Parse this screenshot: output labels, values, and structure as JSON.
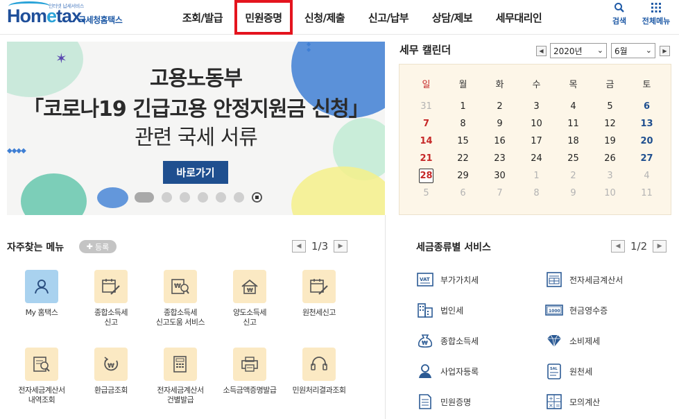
{
  "header": {
    "logo_tagline": "인터넷 납세서비스",
    "logo_text_pre": "Hom",
    "logo_text_e": "e",
    "logo_text_post": "tax.",
    "logo_sub": "국세청홈택스",
    "nav": [
      "조회/발급",
      "민원증명",
      "신청/제출",
      "신고/납부",
      "상담/제보",
      "세무대리인"
    ],
    "active_nav": "민원증명",
    "search_label": "검색",
    "menu_label": "전체메뉴"
  },
  "banner": {
    "line1": "고용노동부",
    "line2": "「코로나19 긴급고용 안정지원금 신청」",
    "line3": "관련 국세 서류",
    "button": "바로가기",
    "slide_count": 7,
    "current_slide": 1
  },
  "calendar": {
    "title": "세무 캘린더",
    "year": "2020년",
    "month": "6월",
    "weekdays": [
      "일",
      "월",
      "화",
      "수",
      "목",
      "금",
      "토"
    ],
    "weeks": [
      [
        "31",
        "1",
        "2",
        "3",
        "4",
        "5",
        "6"
      ],
      [
        "7",
        "8",
        "9",
        "10",
        "11",
        "12",
        "13"
      ],
      [
        "14",
        "15",
        "16",
        "17",
        "18",
        "19",
        "20"
      ],
      [
        "21",
        "22",
        "23",
        "24",
        "25",
        "26",
        "27"
      ],
      [
        "28",
        "29",
        "30",
        "1",
        "2",
        "3",
        "4"
      ],
      [
        "5",
        "6",
        "7",
        "8",
        "9",
        "10",
        "11"
      ]
    ],
    "today": "28"
  },
  "favorites": {
    "title": "자주찾는 메뉴",
    "register": "등록",
    "page": "1/3",
    "items": [
      {
        "label": "My 홈택스",
        "icon": "user-icon"
      },
      {
        "label": "종합소득세\n신고",
        "icon": "calendar-pen-icon"
      },
      {
        "label": "종합소득세\n신고도움 서비스",
        "icon": "won-search-icon"
      },
      {
        "label": "양도소득세\n신고",
        "icon": "house-icon"
      },
      {
        "label": "원천세신고",
        "icon": "calendar-pen-icon"
      },
      {
        "label": "전자세금계산서\n내역조회",
        "icon": "doc-search-icon"
      },
      {
        "label": "환급금조회",
        "icon": "won-refund-icon"
      },
      {
        "label": "전자세금계산서\n건별발급",
        "icon": "doc-calc-icon"
      },
      {
        "label": "소득금액증명발급",
        "icon": "doc-print-icon"
      },
      {
        "label": "민원처리결과조회",
        "icon": "headset-icon"
      }
    ]
  },
  "services": {
    "title": "세금종류별 서비스",
    "page": "1/2",
    "items": [
      {
        "label": "부가가치세",
        "icon": "vat-icon"
      },
      {
        "label": "전자세금계산서",
        "icon": "invoice-icon"
      },
      {
        "label": "법인세",
        "icon": "building-icon"
      },
      {
        "label": "현금영수증",
        "icon": "cash-receipt-icon"
      },
      {
        "label": "종합소득세",
        "icon": "money-bag-icon"
      },
      {
        "label": "소비제세",
        "icon": "diamond-icon"
      },
      {
        "label": "사업자등록",
        "icon": "person-icon"
      },
      {
        "label": "원천세",
        "icon": "salary-doc-icon"
      },
      {
        "label": "민원증명",
        "icon": "document-icon"
      },
      {
        "label": "모의계산",
        "icon": "calculator-icon"
      }
    ]
  },
  "colors": {
    "brand_blue": "#1f4f9a",
    "active_outline": "#e4141e",
    "calendar_bg": "#fdf6e8",
    "sunday": "#c62828",
    "saturday": "#1f4f8f"
  }
}
